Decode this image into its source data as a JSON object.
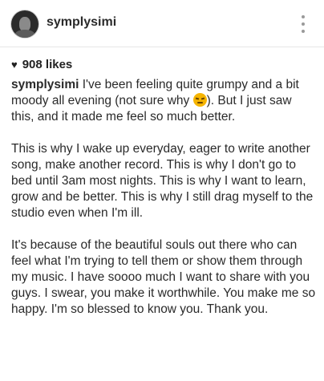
{
  "header": {
    "username": "symplysimi",
    "menu_icon": "more-vertical-icon",
    "avatar_icon": "profile-photo"
  },
  "likes": {
    "icon": "heart-icon",
    "glyph": "♥",
    "text": "908 likes"
  },
  "caption": {
    "username": "symplysimi",
    "p1_before_emoji": " I've been feeling quite grumpy and a bit moody all evening (not sure why ",
    "p1_emoji": "persevering-face-emoji",
    "p1_after_emoji": "). But I just saw this, and it made me feel so much better.",
    "p2": "This is why I wake up everyday, eager to write another song, make another record. This is why I don't go to bed until 3am most nights. This is why I want to learn, grow and be better. This is why I still drag myself to the studio even when I'm ill.",
    "p3": "It's because of the beautiful souls out there who can feel what I'm trying to tell them or show them through my music. I have soooo much I want to share with you guys. I swear, you make it worthwhile. You make me so happy. I'm so blessed to know you. Thank you."
  },
  "colors": {
    "text": "#2a2a2a",
    "muted": "#9a9a9a",
    "divider": "#e6e6e6",
    "emoji": "#f5b400"
  }
}
